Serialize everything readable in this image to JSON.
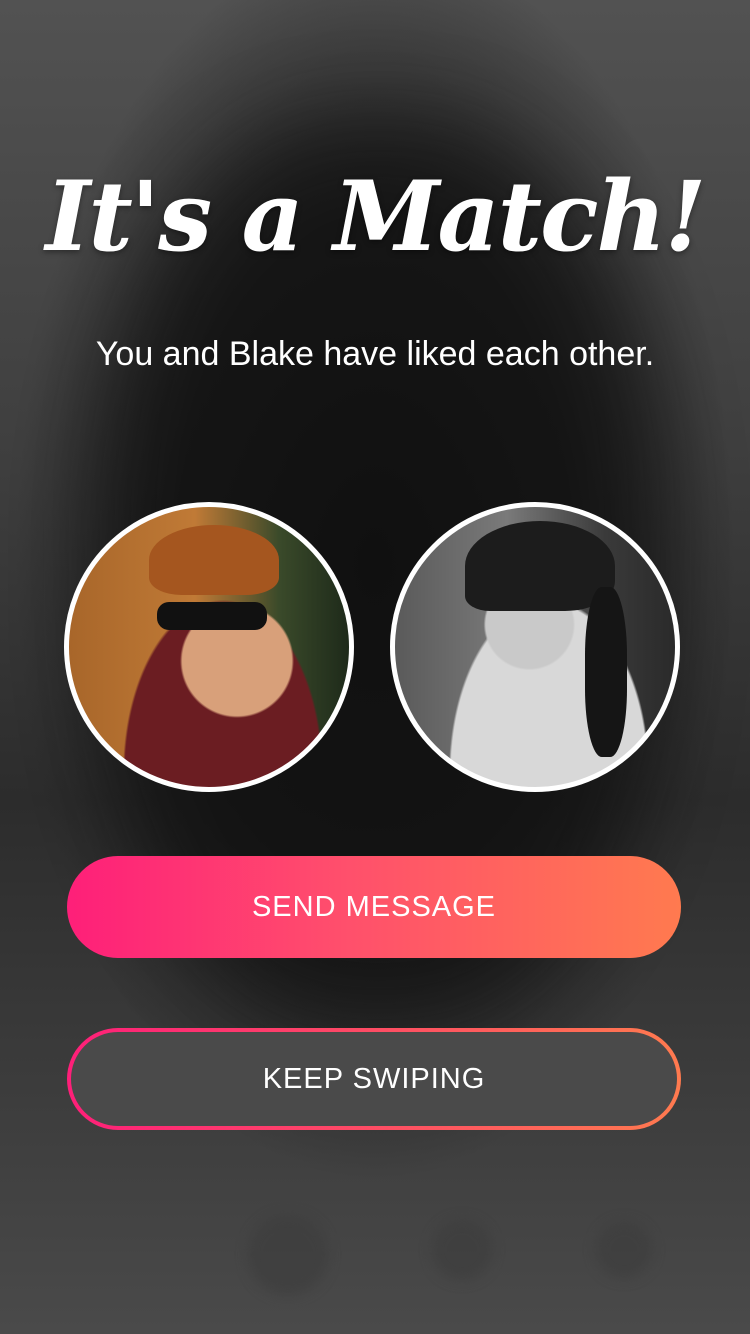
{
  "match": {
    "title": "It's a Match!",
    "subtitle": "You and Blake have liked each other."
  },
  "avatars": {
    "user_photo": "user-profile-photo",
    "match_photo": "blake-profile-photo"
  },
  "actions": {
    "send_message_label": "SEND MESSAGE",
    "keep_swiping_label": "KEEP SWIPING"
  },
  "colors": {
    "gradient_start": "#fe1f79",
    "gradient_end": "#ff7a4f",
    "text": "#ffffff",
    "background": "#2c2c2c"
  }
}
